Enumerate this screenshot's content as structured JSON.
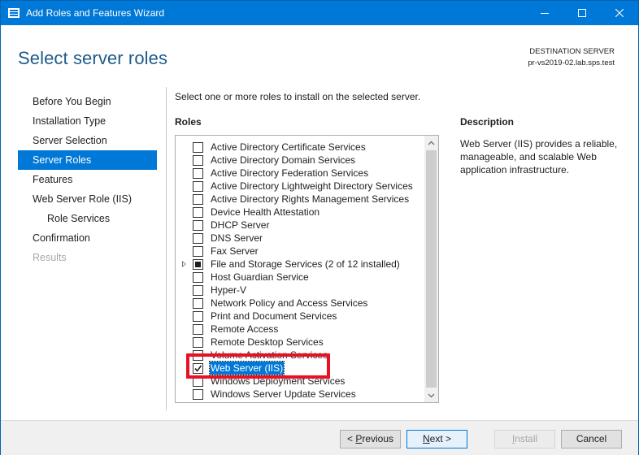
{
  "window": {
    "title": "Add Roles and Features Wizard",
    "minimize_label": "Minimize",
    "maximize_label": "Maximize",
    "close_label": "Close"
  },
  "header": {
    "page_title": "Select server roles",
    "destination_label": "DESTINATION SERVER",
    "destination_server": "pr-vs2019-02.lab.sps.test"
  },
  "nav": {
    "items": [
      {
        "label": "Before You Begin",
        "state": "normal",
        "indent": false
      },
      {
        "label": "Installation Type",
        "state": "normal",
        "indent": false
      },
      {
        "label": "Server Selection",
        "state": "normal",
        "indent": false
      },
      {
        "label": "Server Roles",
        "state": "active",
        "indent": false
      },
      {
        "label": "Features",
        "state": "normal",
        "indent": false
      },
      {
        "label": "Web Server Role (IIS)",
        "state": "normal",
        "indent": false
      },
      {
        "label": "Role Services",
        "state": "normal",
        "indent": true
      },
      {
        "label": "Confirmation",
        "state": "normal",
        "indent": false
      },
      {
        "label": "Results",
        "state": "disabled",
        "indent": false
      }
    ]
  },
  "main": {
    "instruction": "Select one or more roles to install on the selected server.",
    "roles_label": "Roles",
    "description_label": "Description",
    "description_text": "Web Server (IIS) provides a reliable, manageable, and scalable Web application infrastructure.",
    "roles": [
      {
        "label": "Active Directory Certificate Services",
        "state": "unchecked",
        "expandable": false
      },
      {
        "label": "Active Directory Domain Services",
        "state": "unchecked",
        "expandable": false
      },
      {
        "label": "Active Directory Federation Services",
        "state": "unchecked",
        "expandable": false
      },
      {
        "label": "Active Directory Lightweight Directory Services",
        "state": "unchecked",
        "expandable": false
      },
      {
        "label": "Active Directory Rights Management Services",
        "state": "unchecked",
        "expandable": false
      },
      {
        "label": "Device Health Attestation",
        "state": "unchecked",
        "expandable": false
      },
      {
        "label": "DHCP Server",
        "state": "unchecked",
        "expandable": false
      },
      {
        "label": "DNS Server",
        "state": "unchecked",
        "expandable": false
      },
      {
        "label": "Fax Server",
        "state": "unchecked",
        "expandable": false
      },
      {
        "label": "File and Storage Services (2 of 12 installed)",
        "state": "partial",
        "expandable": true
      },
      {
        "label": "Host Guardian Service",
        "state": "unchecked",
        "expandable": false
      },
      {
        "label": "Hyper-V",
        "state": "unchecked",
        "expandable": false
      },
      {
        "label": "Network Policy and Access Services",
        "state": "unchecked",
        "expandable": false
      },
      {
        "label": "Print and Document Services",
        "state": "unchecked",
        "expandable": false
      },
      {
        "label": "Remote Access",
        "state": "unchecked",
        "expandable": false
      },
      {
        "label": "Remote Desktop Services",
        "state": "unchecked",
        "expandable": false
      },
      {
        "label": "Volume Activation Services",
        "state": "unchecked",
        "expandable": false
      },
      {
        "label": "Web Server (IIS)",
        "state": "checked",
        "expandable": false,
        "selected": true
      },
      {
        "label": "Windows Deployment Services",
        "state": "unchecked",
        "expandable": false
      },
      {
        "label": "Windows Server Update Services",
        "state": "unchecked",
        "expandable": false
      }
    ]
  },
  "footer": {
    "previous_prefix": "< ",
    "previous_accel": "P",
    "previous_rest": "revious",
    "next_accel": "N",
    "next_rest": "ext >",
    "install_accel": "I",
    "install_rest": "nstall",
    "cancel_label": "Cancel"
  },
  "colors": {
    "accent": "#0078d7",
    "highlight_annotation": "#e81123",
    "title_text": "#1e5b8a"
  }
}
